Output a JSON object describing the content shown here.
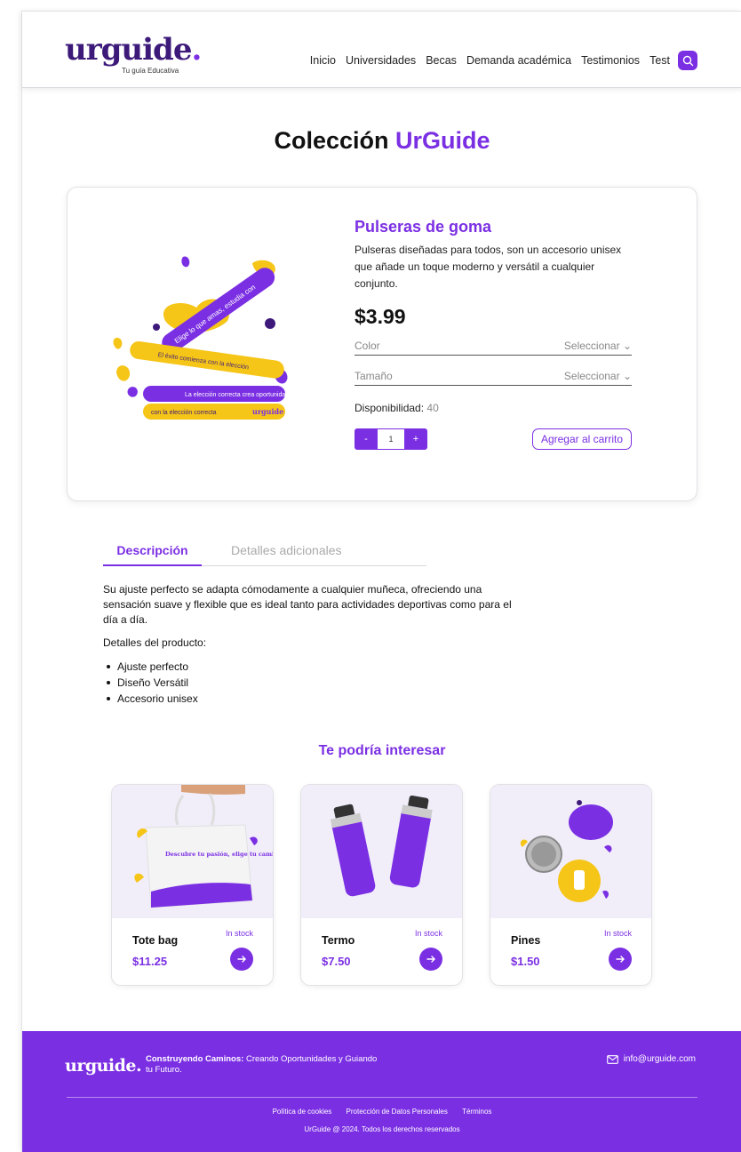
{
  "header": {
    "logo": "urguide",
    "logo_dot": ".",
    "logo_sub": "Tu guía Educativa",
    "nav": [
      "Inicio",
      "Universidades",
      "Becas",
      "Demanda académica",
      "Testimonios",
      "Test"
    ]
  },
  "page_title": {
    "main": "Colección",
    "accent": "UrGuide"
  },
  "product": {
    "name": "Pulseras de goma",
    "description": "Pulseras diseñadas para todos, son un accesorio unisex que añade un toque moderno y versátil a cualquier conjunto.",
    "price": "$3.99",
    "options": [
      {
        "label": "Color",
        "value": "Seleccionar"
      },
      {
        "label": "Tamaño",
        "value": "Seleccionar"
      }
    ],
    "availability_label": "Disponibilidad:",
    "availability_value": "40",
    "qty_minus": "-",
    "qty_value": "1",
    "qty_plus": "+",
    "add_to_cart": "Agregar al carrito",
    "bracelet_texts": [
      "Elige lo que amas, estudia con",
      "El éxito comienza con la elección",
      "La elección correcta crea oportunidades",
      "con la elección correcta",
      "urguide"
    ]
  },
  "tabs": {
    "active": "Descripción",
    "inactive": "Detalles adicionales"
  },
  "details": {
    "paragraph": "Su ajuste perfecto se adapta cómodamente a cualquier muñeca, ofreciendo una sensación suave y flexible que es ideal tanto para actividades deportivas como para el día a día.",
    "list_title": "Detalles del producto:",
    "features": [
      "Ajuste perfecto",
      "Diseño Versátil",
      "Accesorio unisex"
    ]
  },
  "related": {
    "title": "Te podría interesar",
    "items": [
      {
        "name": "Tote bag",
        "price": "$11.25",
        "stock": "In stock",
        "image_text": "Descubre tu pasión, elige tu camino."
      },
      {
        "name": "Termo",
        "price": "$7.50",
        "stock": "In stock"
      },
      {
        "name": "Pines",
        "price": "$1.50",
        "stock": "In stock"
      }
    ]
  },
  "footer": {
    "logo": "urguide.",
    "tagline_bold": "Construyendo Caminos:",
    "tagline_rest": "Creando Oportunidades y Guiando tu Futuro.",
    "email": "info@urguide.com",
    "links": [
      "Política de cookies",
      "Protección de Datos Personales",
      "Términos"
    ],
    "copyright": "UrGuide @ 2024. Todos los derechos reservados"
  },
  "colors": {
    "accent": "#7b2fe3",
    "logo_dark": "#3d1a7a",
    "yellow": "#f5c518"
  }
}
